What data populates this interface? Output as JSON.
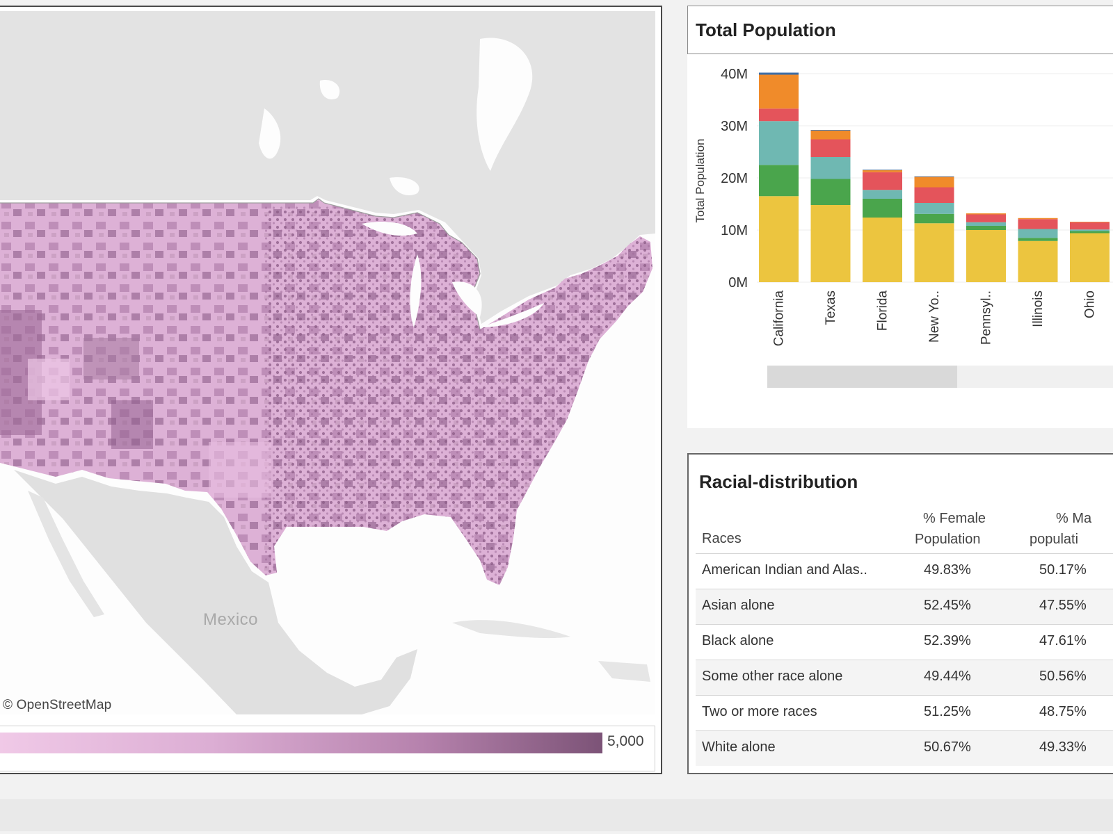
{
  "map": {
    "attribution": "© OpenStreetMap",
    "country_label": "Mexico",
    "legend": {
      "max_label": "5,000",
      "color_start": "#f0c9e7",
      "color_end": "#7c5377"
    }
  },
  "population_chart": {
    "title": "Total Population",
    "chart_data": {
      "type": "bar",
      "stacked": true,
      "title": "Total Population",
      "ylabel": "Total Population",
      "ylim": [
        0,
        40000000
      ],
      "y_ticks": [
        "0M",
        "10M",
        "20M",
        "30M",
        "40M"
      ],
      "categories": [
        "California",
        "Texas",
        "Florida",
        "New Yo..",
        "Pennsyl..",
        "Illinois",
        "Ohio"
      ],
      "series": [
        {
          "color": "#ecc53f",
          "values": [
            16.5,
            14.8,
            12.4,
            11.3,
            10.0,
            7.9,
            9.4
          ]
        },
        {
          "color": "#4aa54c",
          "values": [
            6.0,
            5.0,
            3.6,
            1.8,
            0.8,
            0.6,
            0.4
          ]
        },
        {
          "color": "#6fb8b2",
          "values": [
            8.4,
            4.2,
            1.7,
            2.1,
            0.7,
            1.7,
            0.3
          ]
        },
        {
          "color": "#e4545b",
          "values": [
            2.4,
            3.4,
            3.4,
            3.0,
            1.5,
            1.9,
            1.4
          ]
        },
        {
          "color": "#f08b2a",
          "values": [
            6.5,
            1.7,
            0.4,
            2.0,
            0.2,
            0.2,
            0.1
          ]
        },
        {
          "color": "#3c6ea8",
          "values": [
            0.4,
            0.1,
            0.1,
            0.1,
            0.0,
            0.0,
            0.0
          ]
        }
      ],
      "value_unit": "M"
    },
    "scrollbar": {
      "position": 0.0,
      "visible_fraction": 0.55
    }
  },
  "racial_table": {
    "title": "Racial-distribution",
    "headers": {
      "races": "Races",
      "female_1": "% Female",
      "female_2": "Population",
      "male_1": "% Ma",
      "male_2": "populati"
    },
    "rows": [
      {
        "race": "American Indian and Alas..",
        "female": "49.83%",
        "male": "50.17%"
      },
      {
        "race": "Asian alone",
        "female": "52.45%",
        "male": "47.55%"
      },
      {
        "race": "Black alone",
        "female": "52.39%",
        "male": "47.61%"
      },
      {
        "race": "Some other race alone",
        "female": "49.44%",
        "male": "50.56%"
      },
      {
        "race": "Two or more races",
        "female": "51.25%",
        "male": "48.75%"
      },
      {
        "race": "White alone",
        "female": "50.67%",
        "male": "49.33%"
      }
    ]
  }
}
